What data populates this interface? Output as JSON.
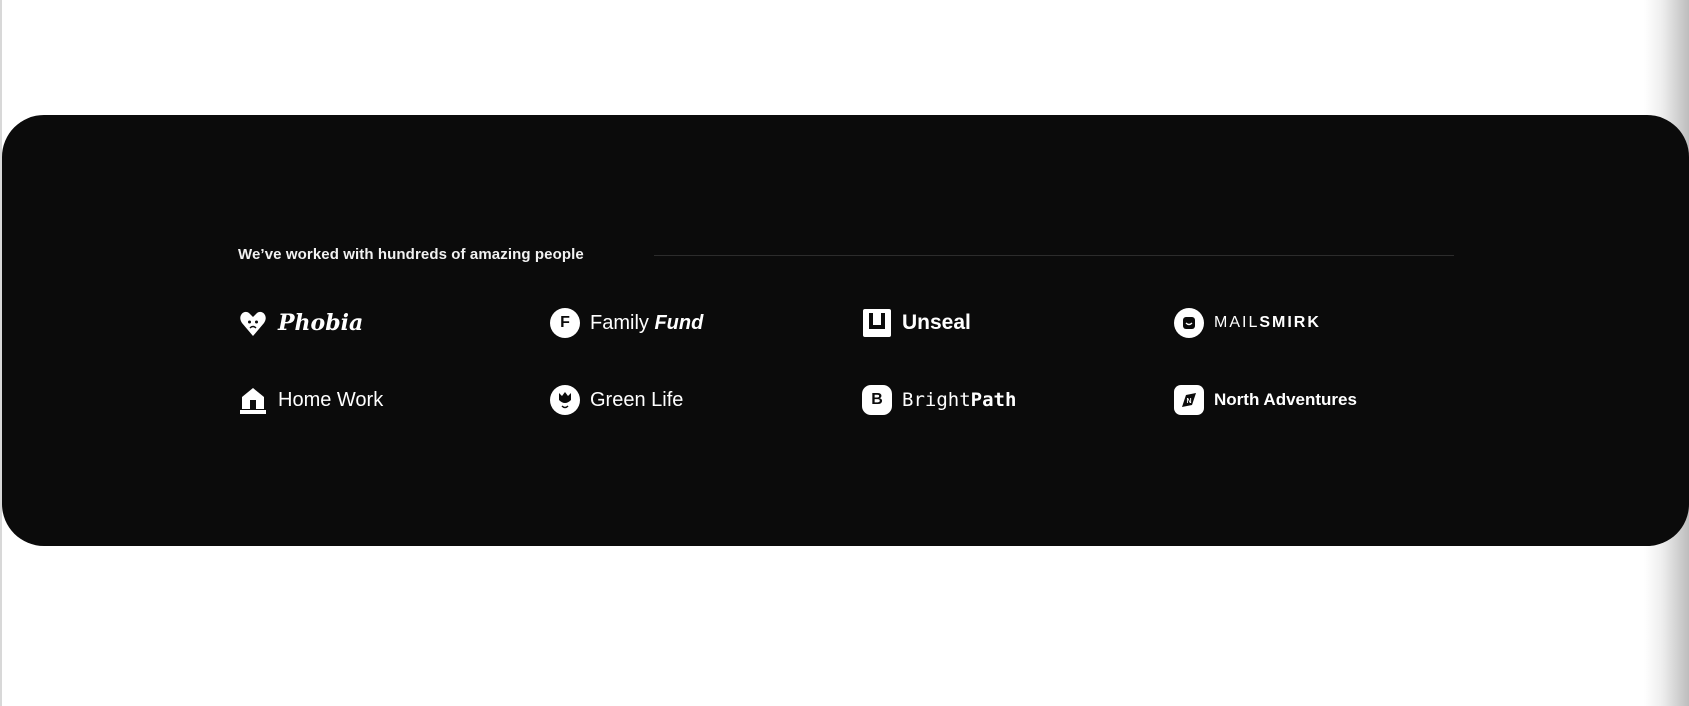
{
  "section": {
    "heading": "We’ve worked with hundreds of amazing people",
    "logos": [
      {
        "name": "Phobia",
        "icon": "sad-heart-icon"
      },
      {
        "name_regular": "Family ",
        "name_bold": "Fund",
        "icon": "f-circle-icon"
      },
      {
        "name": "Unseal",
        "icon": "unseal-square-icon"
      },
      {
        "name_regular": "MAIL",
        "name_bold": "SMIRK",
        "icon": "smirk-circle-icon"
      },
      {
        "name": "Home Work",
        "icon": "house-icon"
      },
      {
        "name": "Green Life",
        "icon": "tulip-circle-icon"
      },
      {
        "name_regular": "Bright",
        "name_bold": "Path",
        "icon": "b-square-icon"
      },
      {
        "name": "North Adventures",
        "icon": "compass-square-icon"
      }
    ]
  },
  "colors": {
    "card_background": "#0b0b0b",
    "text": "#ffffff",
    "divider": "#2c2c2c"
  }
}
